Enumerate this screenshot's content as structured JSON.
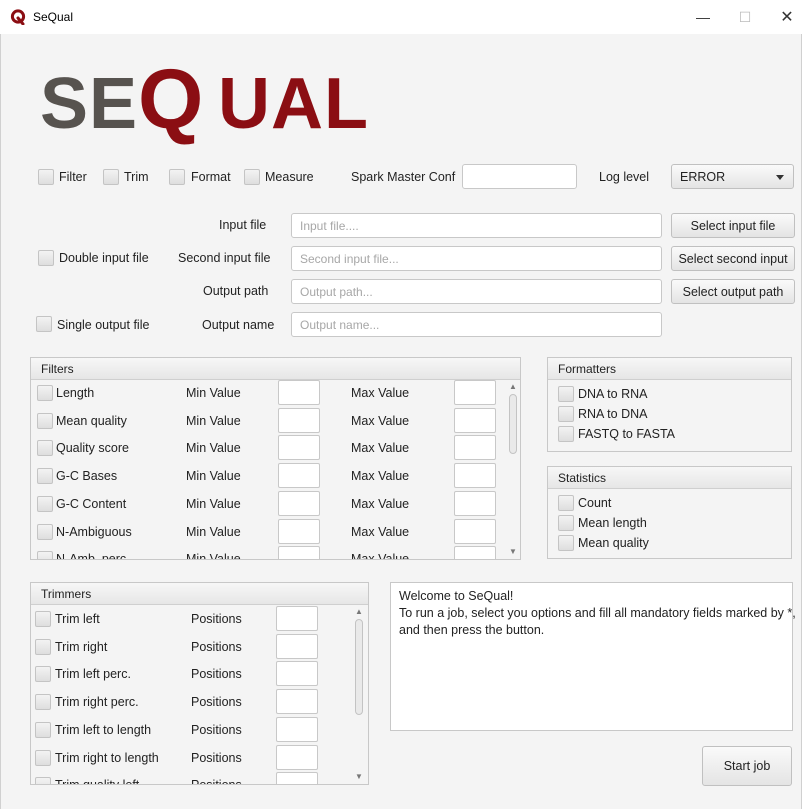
{
  "window": {
    "title": "SeQual",
    "minimize_label": "—",
    "maximize_label": "☐",
    "close_label": "✕"
  },
  "logo": {
    "text_se": "SE",
    "text_q": "Q",
    "text_ual": "UAL",
    "colors": {
      "gray": "#57534f",
      "red": "#8b0e13"
    }
  },
  "options": {
    "filter": "Filter",
    "trim": "Trim",
    "format": "Format",
    "measure": "Measure",
    "spark_label": "Spark Master Conf",
    "spark_value": "",
    "log_label": "Log level",
    "log_value": "ERROR"
  },
  "files": {
    "input_label": "Input file",
    "input_placeholder": "Input file....",
    "input_button": "Select input file",
    "double_input": "Double input file",
    "second_label": "Second input file",
    "second_placeholder": "Second input file...",
    "second_button": "Select second input",
    "output_label": "Output path",
    "output_placeholder": "Output path...",
    "output_button": "Select output path",
    "single_output": "Single output file",
    "name_label": "Output name",
    "name_placeholder": "Output name..."
  },
  "filters": {
    "title": "Filters",
    "min_label": "Min Value",
    "max_label": "Max Value",
    "rows": [
      "Length",
      "Mean quality",
      "Quality score",
      "G-C Bases",
      "G-C Content",
      "N-Ambiguous",
      "N-Amb. perc."
    ]
  },
  "formatters": {
    "title": "Formatters",
    "items": [
      "DNA to RNA",
      "RNA to DNA",
      "FASTQ to FASTA"
    ]
  },
  "statistics": {
    "title": "Statistics",
    "items": [
      "Count",
      "Mean length",
      "Mean quality"
    ]
  },
  "trimmers": {
    "title": "Trimmers",
    "positions_label": "Positions",
    "rows": [
      "Trim left",
      "Trim right",
      "Trim left perc.",
      "Trim right perc.",
      "Trim left to length",
      "Trim right to length",
      "Trim quality left"
    ]
  },
  "console": {
    "lines": [
      "Welcome to SeQual!",
      "To run a job, select you options and fill all mandatory fields marked by *,",
      "and then press the button."
    ]
  },
  "start_button": "Start job"
}
